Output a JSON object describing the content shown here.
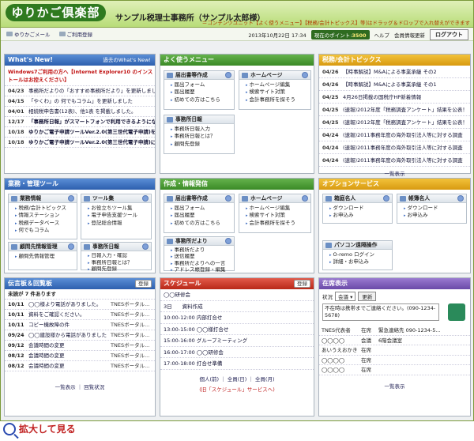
{
  "header": {
    "logo": "ゆりかご倶楽部",
    "office": "サンプル税理士事務所（サンプル太郎様）",
    "marquee": "＝コンテンツユニット【よく使うメニュー】【税務/会計トピックス】等]はドラッグ＆ドロップで入れ替えができます"
  },
  "toolbar": {
    "mail": "ゆりかごメール",
    "register": "ご利用登録",
    "datetime": "2013年10月22日 17:34",
    "points_label": "現在のポイント:",
    "points": "3500",
    "help": "ヘルプ",
    "member": "会員情報更新",
    "logout": "ログアウト"
  },
  "whatsnew": {
    "title": "What's New!",
    "sub": "過去のWhat's New!",
    "items": [
      {
        "d": "",
        "t": "Windows7ご利用の方へ【Internet Explorer10 のインストールはお控えください】",
        "red": true
      },
      {
        "d": "04/23",
        "t": "事務所だよりの「おすすめ事務所だより」を更新しました"
      },
      {
        "d": "04/15",
        "t": "「やくわ」の 何でもコラム」を更新しました"
      },
      {
        "d": "04/01",
        "t": "相続税申告書(12表)、他1表 を掲載しました。"
      },
      {
        "d": "12/17",
        "t": "「事務所日報」がスマートフォンで利用できるようになりました"
      },
      {
        "d": "10/18",
        "t": "ゆりかご電子申請ツールVer.2.0(第三世代電子申請)を公開"
      },
      {
        "d": "10/18",
        "t": "ゆりかご電子申請ツールVer.2.0(第三世代電子申請)について"
      }
    ]
  },
  "favmenu": {
    "title": "よく使うメニュー",
    "boxes": [
      {
        "h": "届出書等作成",
        "items": [
          "届出フォーム",
          "届出履歴",
          "初めての方はこちら"
        ]
      },
      {
        "h": "ホームページ",
        "items": [
          "ホームページ編集",
          "検索サイト対策",
          "会計事務所を探そう"
        ]
      },
      {
        "h": "事務所日報",
        "items": [
          "事務所日報入力",
          "事務所日報とは？",
          "顧問先登録"
        ]
      }
    ]
  },
  "topics": {
    "title": "税務/会計トピックス",
    "items": [
      {
        "d": "04/26",
        "t": "【時事解説】M&Aによる事業承継 その2"
      },
      {
        "d": "04/26",
        "t": "【時事解説】M&Aによる事業承継 その1"
      },
      {
        "d": "04/25",
        "t": "4月26日掲載の国税庁HP新着情報"
      },
      {
        "d": "04/25",
        "t": "(速報)2012年度「税務調査アンケート」結果を公表！"
      },
      {
        "d": "04/25",
        "t": "(速報)2012年度「税務調査アンケート」結果を公表！"
      },
      {
        "d": "04/24",
        "t": "(速報)2011事務年度の海外取引法人等に対する調査"
      },
      {
        "d": "04/24",
        "t": "(速報)2011事務年度の海外取引法人等に対する調査"
      },
      {
        "d": "04/24",
        "t": "(速報)2011事務年度の海外取引法人等に対する調査"
      }
    ],
    "more": "一覧表示"
  },
  "biz": {
    "title": "業務・管理ツール",
    "boxes": [
      {
        "h": "業務情報",
        "items": [
          "税務/会計トピックス",
          "情報ステーション",
          "税務データベース",
          "何でもコラム"
        ]
      },
      {
        "h": "ツール集",
        "items": [
          "お役立ちツール集",
          "電子申告支援ツール",
          "登記総合情報"
        ]
      },
      {
        "h": "顧問先情報管理",
        "items": [
          "顧問先情報管理"
        ]
      },
      {
        "h": "事務所日報",
        "items": [
          "日報入力・確認",
          "事務所日報とは？",
          "顧問先登録"
        ]
      }
    ]
  },
  "create": {
    "title": "作成・情報発信",
    "boxes": [
      {
        "h": "届出書等作成",
        "items": [
          "届出フォーム",
          "届出履歴",
          "初めての方はこちら"
        ]
      },
      {
        "h": "ホームページ",
        "items": [
          "ホームページ編集",
          "検索サイト対策",
          "会計事務所を探そう"
        ]
      },
      {
        "h": "事務所だより",
        "items": [
          "事務所だより",
          "送信履歴",
          "事務所だよりへの一言",
          "アドレス帳登録・編集"
        ]
      }
    ]
  },
  "options": {
    "title": "オプションサービス",
    "boxes": [
      {
        "h": "箱庭名人",
        "items": [
          "ダウンロード",
          "お申込み"
        ]
      },
      {
        "h": "帳簿名人",
        "items": [
          "ダウンロード",
          "お申込み"
        ]
      },
      {
        "h": "パソコン遠隔操作",
        "items": [
          "O-remo ログイン",
          "詳細・お申込み"
        ]
      }
    ]
  },
  "board": {
    "title": "伝言板＆回覧板",
    "reg": "登録",
    "unread": "未読が 7 件あります",
    "items": [
      {
        "d": "10/11",
        "t": "◯◯様より電話がありました。",
        "s": "TNESボータル..."
      },
      {
        "d": "10/11",
        "t": "資料をご確認ください。",
        "s": "TNESボータル..."
      },
      {
        "d": "10/11",
        "t": "コピー機故障の件",
        "s": "TNESボータル..."
      },
      {
        "d": "09/24",
        "t": "◯◯建設様から電話がありました",
        "s": "TNESボータル..."
      },
      {
        "d": "09/12",
        "t": "会議時間の変更",
        "s": "TNESボータル..."
      },
      {
        "d": "08/12",
        "t": "会議時間の変更",
        "s": "TNESボータル..."
      },
      {
        "d": "08/12",
        "t": "会議時間の変更",
        "s": "TNESボータル..."
      }
    ],
    "foot": "一覧表示 ｜ 回覧状況"
  },
  "schedule": {
    "title": "スケジュール",
    "reg": "登録",
    "items": [
      "◯◯研修会",
      "3日　　資料作成",
      "10:00-12:00 内部打合せ",
      "13:00-15:00 ◯◯様打合せ",
      "15:00-16:00 グループミーティング",
      "16:00-17:00 ◯◯研修会",
      "17:00-18:00 打合せ準備"
    ],
    "foot": "個人(前) ｜ 全員(日) ｜ 全員(月)",
    "note": "(旧「スケジュール」サービスへ)"
  },
  "presence": {
    "title": "在席表示",
    "status_label": "状況",
    "status_value": "会議",
    "update": "更新",
    "memo": "不在時は携帯までご連絡ください。(090-1234-5678)",
    "items": [
      {
        "n": "TNES代表者",
        "s": "在席",
        "m": "緊急連絡先 090-1234-5..."
      },
      {
        "n": "◯◯◯◯",
        "s": "会議",
        "m": "6階会議室"
      },
      {
        "n": "あいうえおかき",
        "s": "在席",
        "m": ""
      },
      {
        "n": "◯◯◯◯",
        "s": "在席",
        "m": ""
      },
      {
        "n": "◯◯◯◯",
        "s": "在席",
        "m": ""
      }
    ],
    "more": "一覧表示"
  },
  "zoom": "拡大して見る"
}
